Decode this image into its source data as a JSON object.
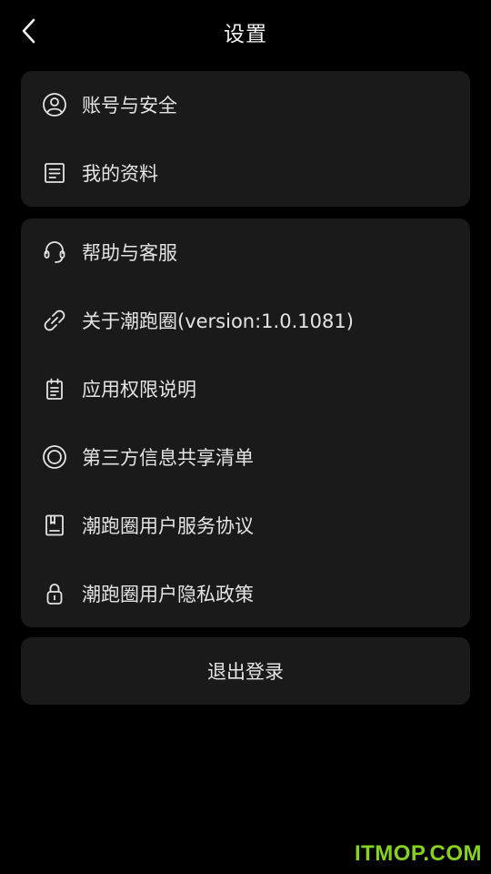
{
  "header": {
    "title": "设置",
    "back_icon": "chevron-left-icon"
  },
  "section_account": {
    "items": [
      {
        "label": "账号与安全",
        "icon": "user-circle-icon"
      },
      {
        "label": "我的资料",
        "icon": "document-icon"
      }
    ]
  },
  "section_info": {
    "items": [
      {
        "label": "帮助与客服",
        "icon": "headset-icon"
      },
      {
        "label": "关于潮跑圈(version:1.0.1081)",
        "icon": "link-icon"
      },
      {
        "label": "应用权限说明",
        "icon": "clipboard-icon"
      },
      {
        "label": "第三方信息共享清单",
        "icon": "target-circle-icon"
      },
      {
        "label": "潮跑圈用户服务协议",
        "icon": "agreement-icon"
      },
      {
        "label": "潮跑圈用户隐私政策",
        "icon": "lock-icon"
      }
    ]
  },
  "logout": {
    "label": "退出登录"
  },
  "watermark": {
    "text": "ITMOP.COM"
  },
  "colors": {
    "background": "#000000",
    "card": "#1a1a1a",
    "text": "#e4e4e4",
    "watermark": "#86d21f"
  }
}
